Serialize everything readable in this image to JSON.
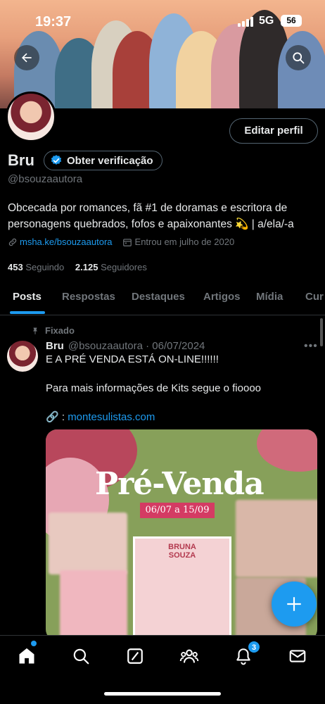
{
  "status_bar": {
    "time": "19:37",
    "network": "5G",
    "battery": "56"
  },
  "profile": {
    "name": "Bru",
    "verify_label": "Obter verificação",
    "handle": "@bsouzaautora",
    "edit_label": "Editar perfil",
    "bio_line1": "Obcecada por romances, fã #1 de doramas e escritora de",
    "bio_line2": "personagens quebrados, fofos e apaixonantes 💫 | a/ela/-a",
    "link": "msha.ke/bsouzaautora",
    "joined": "Entrou em julho de 2020",
    "following_count": "453",
    "following_label": "Seguindo",
    "followers_count": "2.125",
    "followers_label": "Seguidores"
  },
  "tabs": [
    "Posts",
    "Respostas",
    "Destaques",
    "Artigos",
    "Mídia",
    "Cur"
  ],
  "post": {
    "pinned_label": "Fixado",
    "author": "Bru",
    "handle_date": "@bsouzaautora · 06/07/2024",
    "line1": "E A PRÉ VENDA ESTÁ ON-LINE!!!!!!",
    "line2": "Para mais informações de Kits segue o fioooo",
    "link_prefix": "🔗 : ",
    "link": "montesulistas.com",
    "media_title": "Pré-Venda",
    "media_dates": "06/07 a 15/09",
    "book_author_1": "BRUNA",
    "book_author_2": "SOUZA"
  },
  "nav": {
    "notification_count": "3"
  },
  "colors": {
    "accent": "#1d9bf0",
    "background": "#000000",
    "muted": "#71767b"
  }
}
